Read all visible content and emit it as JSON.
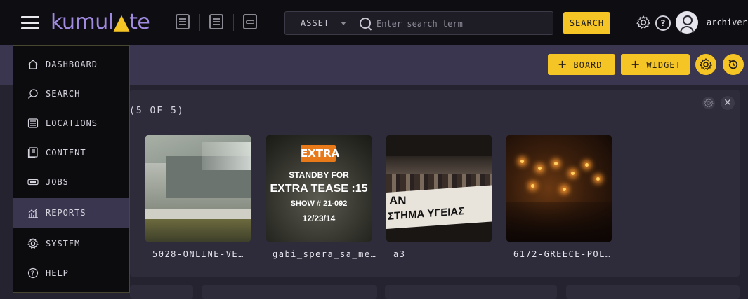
{
  "app": {
    "logo_text_a": "kumul",
    "logo_text_b": "te",
    "username": "archiver"
  },
  "search": {
    "asset_type": "ASSET",
    "placeholder": "Enter search term",
    "button_label": "SEARCH"
  },
  "toolbar": {
    "board_label": "BOARD",
    "widget_label": "WIDGET"
  },
  "panel": {
    "count_label": "(5 OF 5)"
  },
  "assets": [
    {
      "label": "5028-ONLINE-VE…"
    },
    {
      "label": "gabi_spera_sa_me…"
    },
    {
      "label": "a3"
    },
    {
      "label": "6172-GREECE-POL…"
    }
  ],
  "thumb2_overlay": {
    "badge": "EXTRA",
    "line1": "STANDBY FOR",
    "line2": "EXTRA TEASE :15",
    "line3": "SHOW # 21-092",
    "line4": "12/23/14"
  },
  "thumb3_overlay": {
    "line1": "AN",
    "line2": "ΣΤΗΜΑ ΥΓΕΙΑΣ"
  },
  "sidebar": {
    "items": [
      {
        "label": "DASHBOARD",
        "icon": "home-icon"
      },
      {
        "label": "SEARCH",
        "icon": "search-icon"
      },
      {
        "label": "LOCATIONS",
        "icon": "storage-icon"
      },
      {
        "label": "CONTENT",
        "icon": "content-icon"
      },
      {
        "label": "JOBS",
        "icon": "tape-icon"
      },
      {
        "label": "REPORTS",
        "icon": "chart-icon",
        "active": true
      },
      {
        "label": "SYSTEM",
        "icon": "gear-icon"
      },
      {
        "label": "HELP",
        "icon": "help-icon"
      }
    ]
  },
  "colors": {
    "accent": "#f5c425",
    "brand": "#a08ae0",
    "active_item": "#3a3650"
  }
}
